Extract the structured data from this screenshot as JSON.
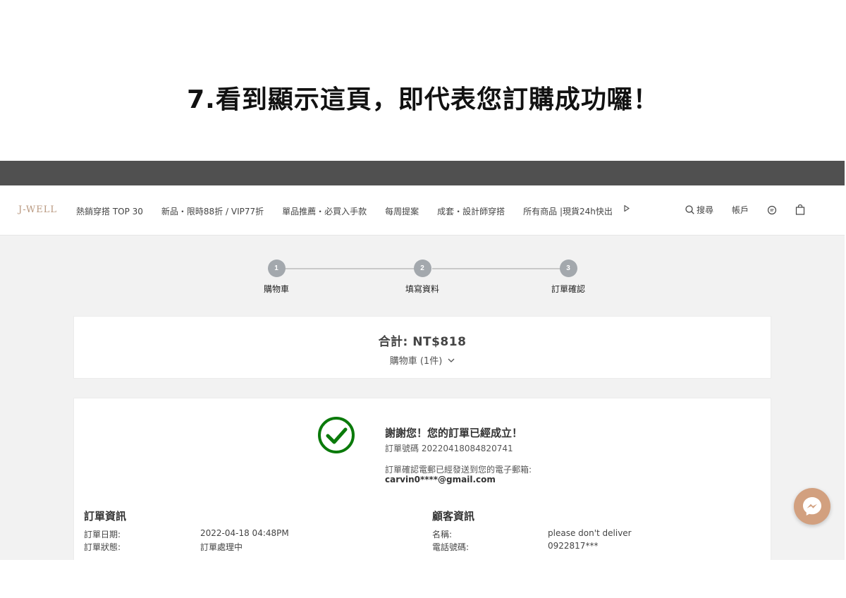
{
  "caption": "7.看到顯示這頁，即代表您訂購成功囉！",
  "brand": {
    "logo": "J-WELL",
    "accent": "#b8977e"
  },
  "nav": {
    "items": [
      "熱銷穿搭 TOP 30",
      "新品・限時88折 / VIP77折",
      "單品推薦・必買入手款",
      "每周提案",
      "成套・設計師穿搭",
      "所有商品 |現貨24h快出"
    ],
    "search": "搜尋",
    "account": "帳戶"
  },
  "steps": [
    {
      "num": "1",
      "label": "購物車"
    },
    {
      "num": "2",
      "label": "填寫資料"
    },
    {
      "num": "3",
      "label": "訂單確認"
    }
  ],
  "summary": {
    "total": "合計: NT$818",
    "cart": "購物車 (1件)"
  },
  "confirmation": {
    "thanks": "謝謝您！您的訂單已經成立！",
    "order_number": "訂單號碼 20220418084820741",
    "email_note": "訂單確認電郵已經發送到您的電子郵箱:",
    "email": "carvin0****@gmail.com",
    "check_color": "#0a7a0a"
  },
  "order_info": {
    "title": "訂單資訊",
    "rows": [
      {
        "label": "訂單日期:",
        "value": "2022-04-18 04:48PM"
      },
      {
        "label": "訂單狀態:",
        "value": "訂單處理中"
      }
    ]
  },
  "customer_info": {
    "title": "顧客資訊",
    "rows": [
      {
        "label": "名稱:",
        "value": "please don't deliver"
      },
      {
        "label": "電話號碼:",
        "value": "0922817***"
      }
    ]
  }
}
